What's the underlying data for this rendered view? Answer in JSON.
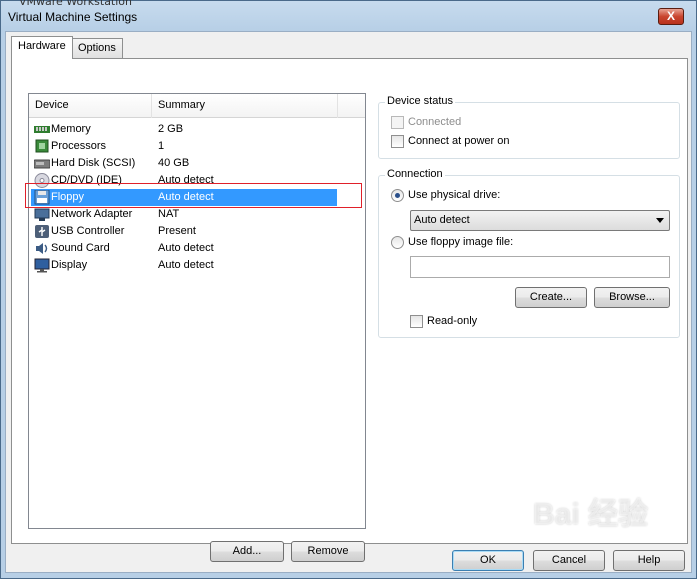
{
  "window": {
    "behind_title": "VMware Workstation",
    "title": "Virtual Machine Settings",
    "close_glyph": "X"
  },
  "tabs": [
    {
      "label": "Hardware",
      "active": true
    },
    {
      "label": "Options",
      "active": false
    }
  ],
  "device_list": {
    "columns": [
      "Device",
      "Summary"
    ],
    "rows": [
      {
        "name": "Memory",
        "summary": "2 GB",
        "icon": "memory-icon"
      },
      {
        "name": "Processors",
        "summary": "1",
        "icon": "processor-icon"
      },
      {
        "name": "Hard Disk (SCSI)",
        "summary": "40 GB",
        "icon": "hard-disk-icon"
      },
      {
        "name": "CD/DVD (IDE)",
        "summary": "Auto detect",
        "icon": "cd-dvd-icon"
      },
      {
        "name": "Floppy",
        "summary": "Auto detect",
        "icon": "floppy-icon",
        "selected": true
      },
      {
        "name": "Network Adapter",
        "summary": "NAT",
        "icon": "network-adapter-icon"
      },
      {
        "name": "USB Controller",
        "summary": "Present",
        "icon": "usb-icon"
      },
      {
        "name": "Sound Card",
        "summary": "Auto detect",
        "icon": "sound-card-icon"
      },
      {
        "name": "Display",
        "summary": "Auto detect",
        "icon": "display-icon"
      }
    ]
  },
  "list_buttons": {
    "add": "Add...",
    "remove": "Remove"
  },
  "device_status": {
    "legend": "Device status",
    "connected": {
      "label": "Connected",
      "checked": false,
      "enabled": false
    },
    "connect_at_power_on": {
      "label": "Connect at power on",
      "checked": false,
      "enabled": true
    }
  },
  "connection": {
    "legend": "Connection",
    "use_physical": {
      "label": "Use physical drive:",
      "selected": true
    },
    "physical_select_value": "Auto detect",
    "use_image": {
      "label": "Use floppy image file:",
      "selected": false
    },
    "image_path": "",
    "create_button": "Create...",
    "browse_button": "Browse...",
    "read_only": {
      "label": "Read-only",
      "checked": false
    }
  },
  "footer": {
    "ok": "OK",
    "cancel": "Cancel",
    "help": "Help"
  },
  "watermark": "Bai 经验",
  "colors": {
    "selection": "#3399ff",
    "highlight_box": "#e0202a",
    "title_gradient": "#b7cfe6"
  }
}
